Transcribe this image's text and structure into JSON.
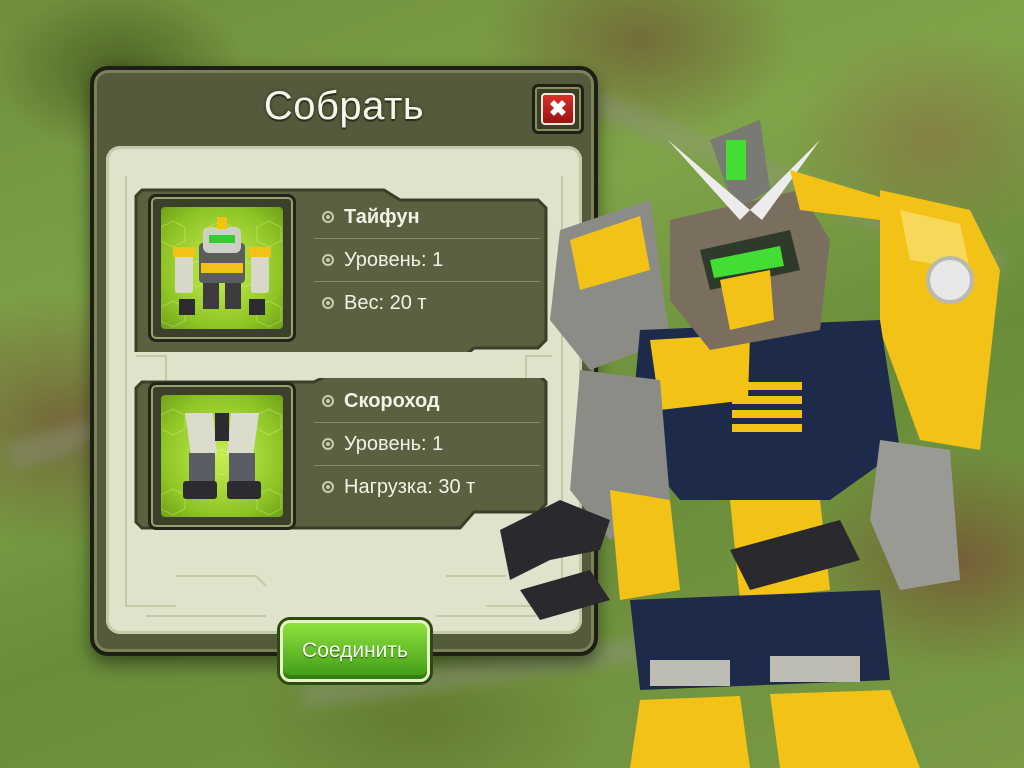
{
  "dialog": {
    "title": "Собрать",
    "close_label": "✖"
  },
  "parts": [
    {
      "name": "Тайфун",
      "stats": [
        "Уровень: 1",
        "Вес: 20 т"
      ]
    },
    {
      "name": "Скороход",
      "stats": [
        "Уровень: 1",
        "Нагрузка: 30 т"
      ]
    }
  ],
  "actions": {
    "combine_label": "Соединить"
  },
  "colors": {
    "panel": "#545a3c",
    "inner": "#dfe3cb",
    "accent_green": "#6fbf2a",
    "close_red": "#c0241c",
    "robot_yellow": "#f2c316"
  }
}
